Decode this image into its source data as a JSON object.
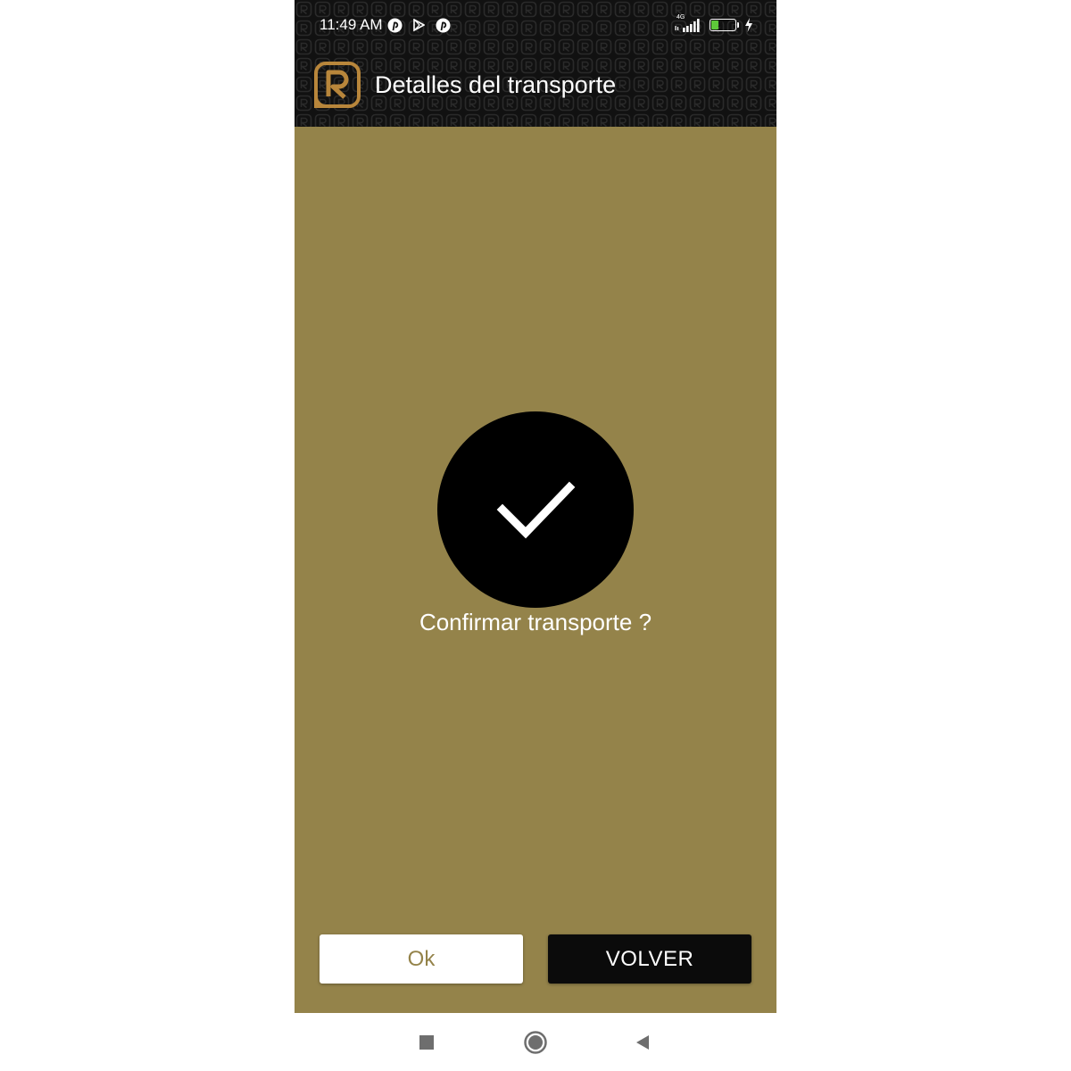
{
  "status_bar": {
    "time": "11:49 AM",
    "network_type": "4G",
    "battery_level": "27",
    "battery_fraction": 0.27,
    "icons_left": [
      "pinterest-icon",
      "play-store-icon",
      "pinterest-icon"
    ],
    "icons_right": [
      "signal-icon",
      "battery-icon",
      "charging-icon"
    ]
  },
  "app_bar": {
    "title": "Detalles del transporte",
    "logo_icon": "app-logo-icon"
  },
  "dialog": {
    "icon": "checkmark-icon",
    "message": "Confirmar transporte ?"
  },
  "buttons": {
    "ok_label": "Ok",
    "back_label": "VOLVER"
  },
  "nav_bar": {
    "items": [
      "recents-button",
      "home-button",
      "back-button"
    ]
  },
  "colors": {
    "header_bg": "#111111",
    "content_bg": "#94834a",
    "accent_gold": "#b8863b",
    "ok_button_bg": "#ffffff",
    "ok_button_text": "#94834a",
    "back_button_bg": "#0b0b0b",
    "battery_fill": "#5ec83a"
  }
}
